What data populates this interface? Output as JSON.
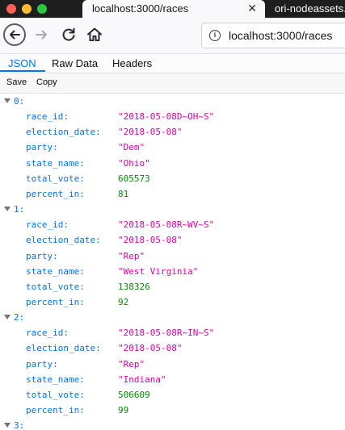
{
  "browser": {
    "tabs": [
      {
        "title": "localhost:3000/races",
        "close": "✕"
      },
      {
        "title": "ori-nodeassets.n"
      }
    ],
    "url": "localhost:3000/races"
  },
  "viewer": {
    "tabs": [
      "JSON",
      "Raw Data",
      "Headers"
    ],
    "actions": {
      "save": "Save",
      "copy": "Copy"
    }
  },
  "races": [
    {
      "index": "0:",
      "fields": [
        {
          "key": "race_id:",
          "value": "\"2018-05-08D~OH~S\"",
          "type": "str"
        },
        {
          "key": "election_date:",
          "value": "\"2018-05-08\"",
          "type": "str"
        },
        {
          "key": "party:",
          "value": "\"Dem\"",
          "type": "str"
        },
        {
          "key": "state_name:",
          "value": "\"Ohio\"",
          "type": "str"
        },
        {
          "key": "total_vote:",
          "value": "605573",
          "type": "num"
        },
        {
          "key": "percent_in:",
          "value": "81",
          "type": "num"
        }
      ]
    },
    {
      "index": "1:",
      "fields": [
        {
          "key": "race_id:",
          "value": "\"2018-05-08R~WV~S\"",
          "type": "str"
        },
        {
          "key": "election_date:",
          "value": "\"2018-05-08\"",
          "type": "str"
        },
        {
          "key": "party:",
          "value": "\"Rep\"",
          "type": "str"
        },
        {
          "key": "state_name:",
          "value": "\"West Virginia\"",
          "type": "str"
        },
        {
          "key": "total_vote:",
          "value": "138326",
          "type": "num"
        },
        {
          "key": "percent_in:",
          "value": "92",
          "type": "num"
        }
      ]
    },
    {
      "index": "2:",
      "fields": [
        {
          "key": "race_id:",
          "value": "\"2018-05-08R~IN~S\"",
          "type": "str"
        },
        {
          "key": "election_date:",
          "value": "\"2018-05-08\"",
          "type": "str"
        },
        {
          "key": "party:",
          "value": "\"Rep\"",
          "type": "str"
        },
        {
          "key": "state_name:",
          "value": "\"Indiana\"",
          "type": "str"
        },
        {
          "key": "total_vote:",
          "value": "506609",
          "type": "num"
        },
        {
          "key": "percent_in:",
          "value": "99",
          "type": "num"
        }
      ]
    },
    {
      "index": "3:",
      "fields": []
    }
  ]
}
